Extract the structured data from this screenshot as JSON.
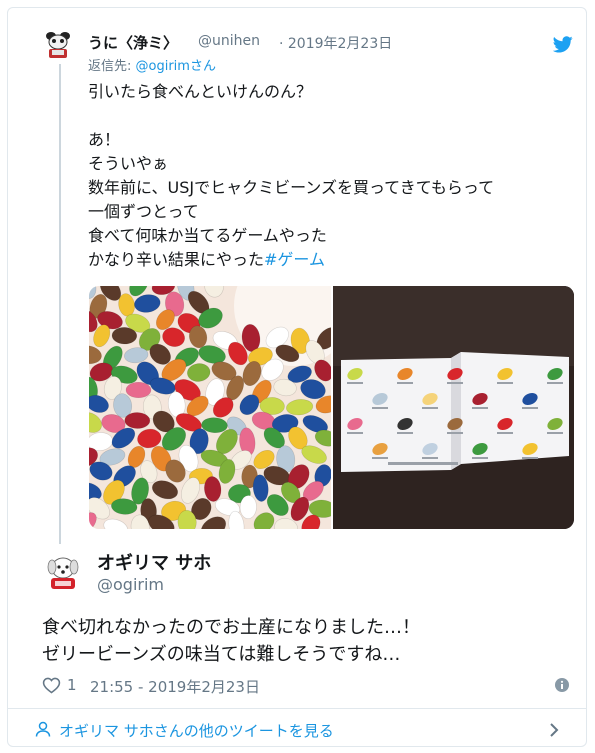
{
  "quoted_tweet": {
    "display_name": "うに〈浄ミ〉",
    "handle": "@unihen",
    "date": "· 2019年2月23日",
    "reply_prefix": "返信先: ",
    "reply_to": "@ogirimさん",
    "lines": [
      "引いたら食べんといけんのん？",
      "",
      "あ！",
      "そういやぁ",
      "数年前に、USJでヒャクミビーンズを買ってきてもらって",
      "一個ずつとって",
      "食べて何味か当てるゲームやった"
    ],
    "last_line_text": "かなり辛い結果にやった",
    "hashtag": "#ゲーム",
    "brand_color": "#1da1f2"
  },
  "main_tweet": {
    "display_name": "オギリマ サホ",
    "handle": "@ogirim",
    "lines": [
      "食べ切れなかったのでお土産になりました…！",
      "ゼリービーンズの味当ては難しそうですね…"
    ],
    "like_count": "1",
    "timestamp": "21:55 - 2019年2月23日"
  },
  "footer": {
    "more_tweets_label": "オギリマ サホさんの他のツイートを見る"
  },
  "icons": {
    "bird": "twitter-bird-icon",
    "heart": "heart-icon",
    "info": "info-icon",
    "user": "user-icon",
    "chevron": "chevron-right-icon"
  }
}
